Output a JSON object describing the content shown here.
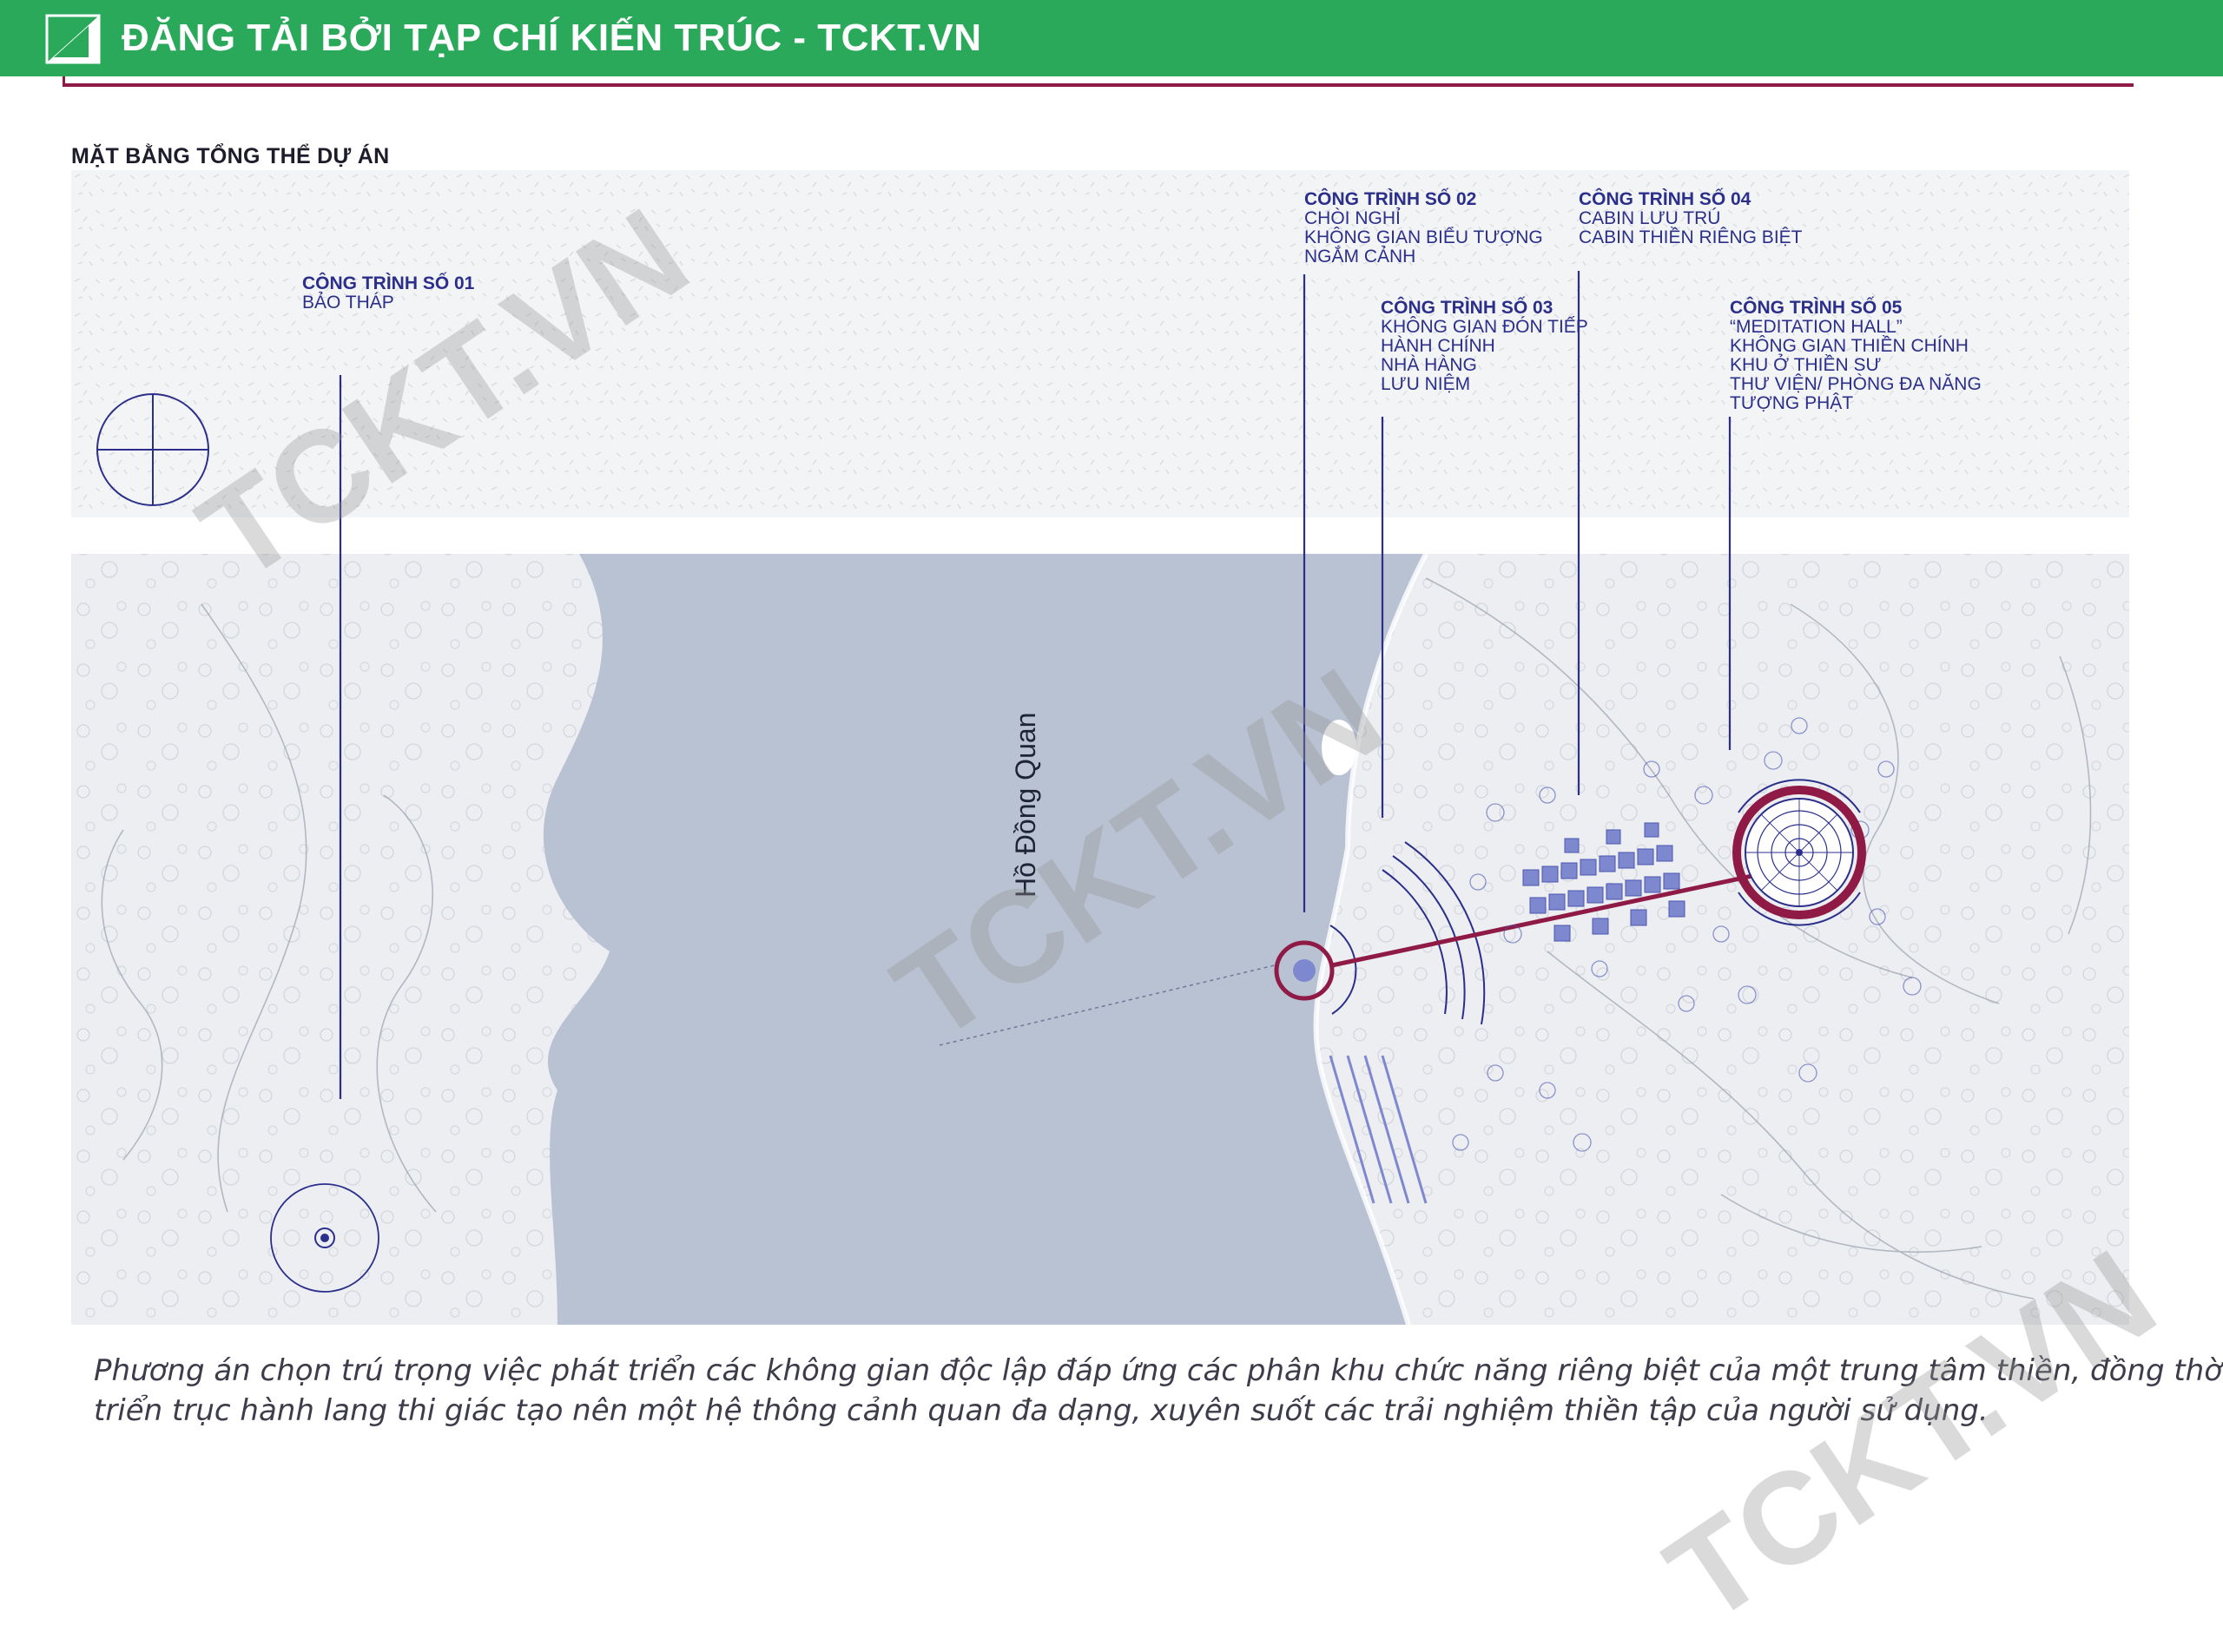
{
  "banner": {
    "text": "ĐĂNG TẢI BỞI TẠP CHÍ KIẾN TRÚC - TCKT.VN"
  },
  "section_title": "MẶT BẰNG TỔNG THỂ DỰ ÁN",
  "lake_name": "Hồ Đồng Quan",
  "labels": [
    {
      "title": "CÔNG TRÌNH SỐ 01",
      "lines": [
        "BẢO THÁP"
      ]
    },
    {
      "title": "CÔNG TRÌNH SỐ 02",
      "lines": [
        "CHÒI NGHỈ",
        "KHÔNG GIAN BIỂU TƯỢNG",
        "NGẮM CẢNH"
      ]
    },
    {
      "title": "CÔNG TRÌNH SỐ 03",
      "lines": [
        "KHÔNG GIAN ĐÓN TIẾP",
        "HÀNH CHÍNH",
        "NHÀ HÀNG",
        "LƯU NIỆM"
      ]
    },
    {
      "title": "CÔNG TRÌNH SỐ 04",
      "lines": [
        "CABIN LƯU TRÚ",
        "CABIN THIỀN RIÊNG BIỆT"
      ]
    },
    {
      "title": "CÔNG TRÌNH SỐ 05",
      "lines": [
        "“MEDITATION HALL”",
        "KHÔNG GIAN THIỀN CHÍNH",
        "KHU Ở THIỀN SƯ",
        "THƯ VIỆN/ PHÒNG ĐA NĂNG",
        "TƯỢNG PHẬT"
      ]
    }
  ],
  "caption": [
    "Phương án chọn trú trọng việc phát triển các không gian độc lập đáp ứng các phân khu chức năng riêng biệt của một trung tâm thiền, đồng thời phát",
    "triển trục hành lang thi giác tạo nên một hệ thông cảnh quan đa dạng, xuyên suốt các trải nghiệm thiền tập của người sử dụng."
  ],
  "watermark": "TCKT.VN",
  "colors": {
    "banner": "#2aa95a",
    "accent": "#8e1a45",
    "label": "#2b2f8a",
    "lake": "#b9c2d2",
    "land": "#eef0f3",
    "building": "#7e88cf"
  }
}
